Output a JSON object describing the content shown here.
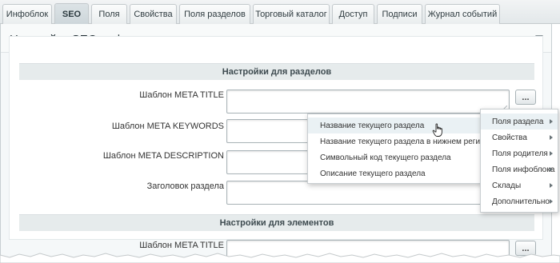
{
  "tabs": [
    {
      "label": "Инфоблок"
    },
    {
      "label": "SEO"
    },
    {
      "label": "Поля"
    },
    {
      "label": "Свойства"
    },
    {
      "label": "Поля разделов"
    },
    {
      "label": "Торговый каталог"
    },
    {
      "label": "Доступ"
    },
    {
      "label": "Подписи"
    },
    {
      "label": "Журнал событий"
    }
  ],
  "active_tab": "SEO",
  "panel": {
    "title": "Настройки SEO информации"
  },
  "sections": {
    "sections_head": "Настройки для разделов",
    "elements_head": "Настройки для элементов"
  },
  "fields": {
    "meta_title_label": "Шаблон META TITLE",
    "meta_keywords_label": "Шаблон META KEYWORDS",
    "meta_description_label": "Шаблон META DESCRIPTION",
    "section_heading_label": "Заголовок раздела",
    "el_meta_title_label": "Шаблон META TITLE",
    "dots_label": "..."
  },
  "menu": {
    "items": [
      {
        "label": "Поля раздела"
      },
      {
        "label": "Свойства"
      },
      {
        "label": "Поля родителя"
      },
      {
        "label": "Поля инфоблока"
      },
      {
        "label": "Склады"
      },
      {
        "label": "Дополнительно"
      }
    ]
  },
  "submenu": {
    "items": [
      {
        "label": "Название текущего раздела"
      },
      {
        "label": "Название текущего раздела в нижнем регистре"
      },
      {
        "label": "Символьный код текущего раздела"
      },
      {
        "label": "Описание текущего раздела"
      }
    ]
  },
  "colors": {
    "background": "#f5f8f9",
    "accent": "#cdd6da",
    "menu_hover": "#eaf1f4"
  },
  "icons": {
    "collapse": "triangle-down-icon",
    "submenu_arrow": "chevron-right-icon",
    "cursor": "hand-pointer-icon"
  }
}
